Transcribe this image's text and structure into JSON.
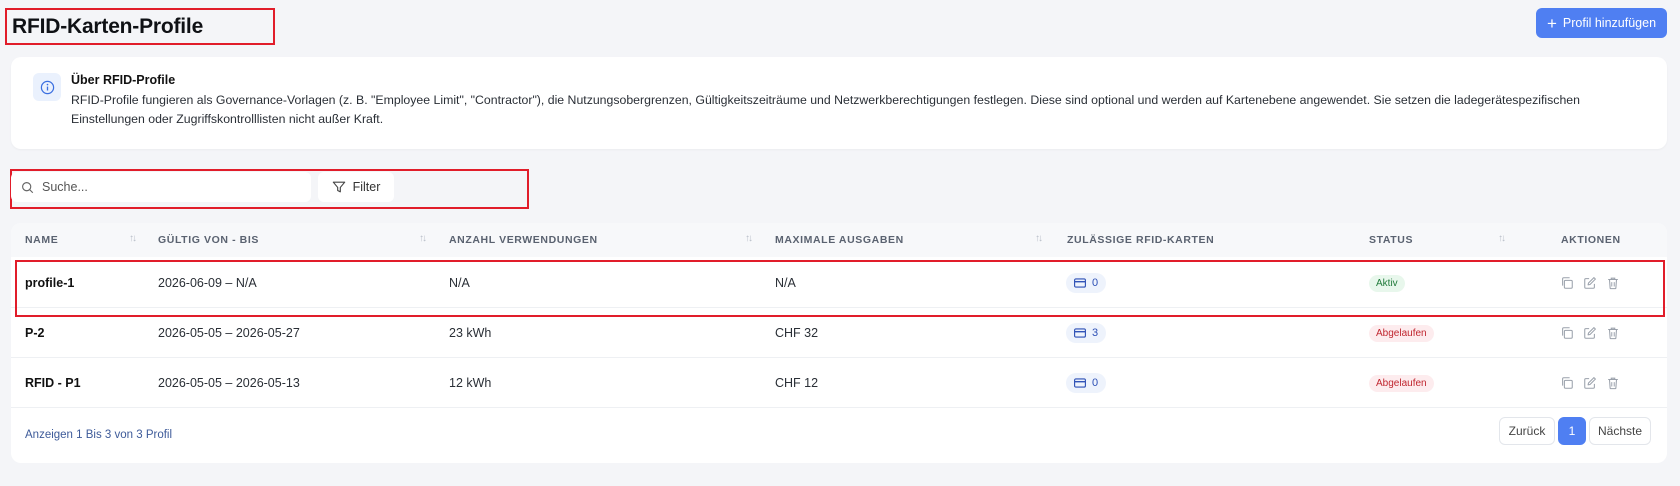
{
  "header": {
    "title": "RFID-Karten-Profile",
    "add_button": "Profil hinzufügen"
  },
  "info": {
    "title": "Über RFID-Profile",
    "text": "RFID-Profile fungieren als Governance-Vorlagen (z. B. \"Employee Limit\", \"Contractor\"), die Nutzungsobergrenzen, Gültigkeitszeiträume und Netzwerkberechtigungen festlegen. Diese sind optional und werden auf Kartenebene angewendet. Sie setzen die ladegerätespezifischen Einstellungen oder Zugriffskontrolllisten nicht außer Kraft."
  },
  "toolbar": {
    "search_placeholder": "Suche...",
    "filter_label": "Filter"
  },
  "table": {
    "columns": {
      "name": "NAME",
      "valid": "GÜLTIG VON - BIS",
      "uses": "ANZAHL VERWENDUNGEN",
      "max": "MAXIMALE AUSGABEN",
      "cards": "ZULÄSSIGE RFID-KARTEN",
      "status": "STATUS",
      "actions": "AKTIONEN"
    },
    "rows": [
      {
        "name": "profile-1",
        "valid": "2026-06-09 – N/A",
        "uses": "N/A",
        "max": "N/A",
        "cards": "0",
        "status": "Aktiv"
      },
      {
        "name": "P-2",
        "valid": "2026-05-05 – 2026-05-27",
        "uses": "23 kWh",
        "max": "CHF 32",
        "cards": "3",
        "status": "Abgelaufen"
      },
      {
        "name": "RFID - P1",
        "valid": "2026-05-05 – 2026-05-13",
        "uses": "12 kWh",
        "max": "CHF 12",
        "cards": "0",
        "status": "Abgelaufen"
      }
    ]
  },
  "footer": {
    "summary": "Anzeigen 1 Bis 3 von 3 Profil",
    "prev": "Zurück",
    "page": "1",
    "next": "Nächste"
  },
  "colors": {
    "primary": "#4f7ff2",
    "active_status": "#1f7a3a",
    "expired_status": "#c0262f",
    "highlight": "#e11d2a"
  }
}
